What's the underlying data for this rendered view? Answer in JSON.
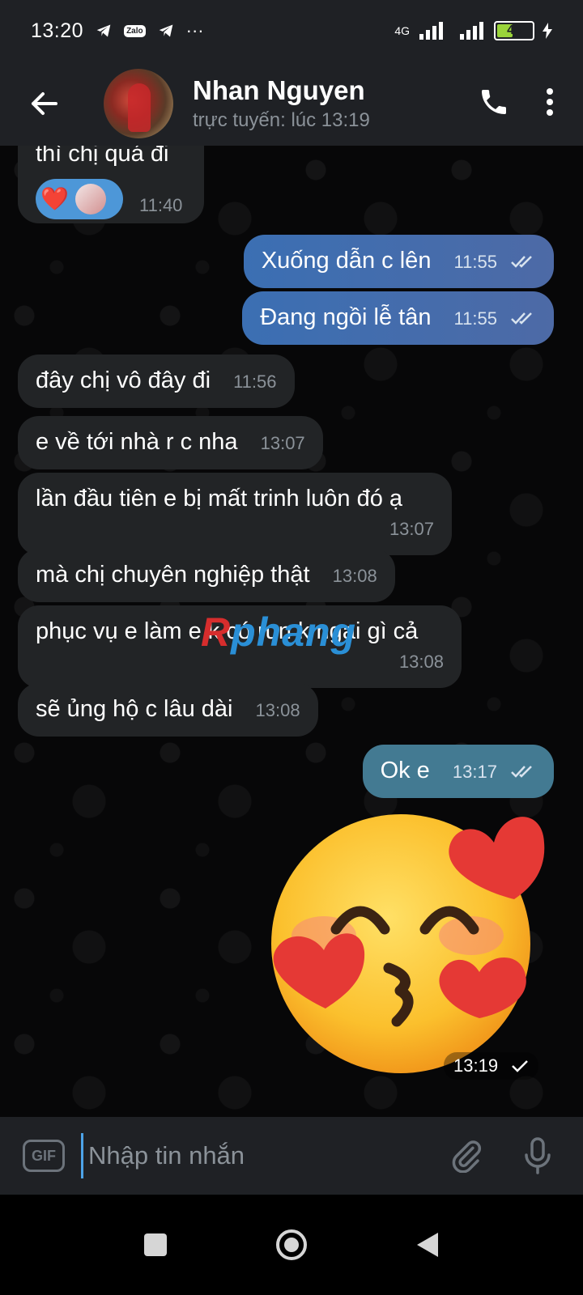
{
  "status_bar": {
    "time": "13:20",
    "network": "4G",
    "battery": "44",
    "zalo": "Zalo",
    "more": "···"
  },
  "header": {
    "name": "Nhan Nguyen",
    "status": "trực tuyến: lúc 13:19"
  },
  "messages": [
    {
      "side": "in",
      "text": "thì chị quá đi",
      "time": "11:40"
    },
    {
      "side": "out",
      "text": "Xuống dẫn c lên",
      "time": "11:55"
    },
    {
      "side": "out",
      "text": "Đang ngồi lễ tân",
      "time": "11:55"
    },
    {
      "side": "in",
      "text": "đây chị vô đây đi",
      "time": "11:56"
    },
    {
      "side": "in",
      "text": "e về tới nhà r c nha",
      "time": "13:07"
    },
    {
      "side": "in",
      "text": "lần đầu tiên e bị mất trinh luôn đó ạ",
      "time": "13:07"
    },
    {
      "side": "in",
      "text": "mà chị chuyên nghiệp thật",
      "time": "13:08"
    },
    {
      "side": "in",
      "text": "phục vụ e làm e k có run k ngại gì cả",
      "time": "13:08"
    },
    {
      "side": "in",
      "text": "sẽ ủng hộ c lâu dài",
      "time": "13:08"
    },
    {
      "side": "out",
      "text": "Ok e",
      "time": "13:17"
    }
  ],
  "reaction": {
    "emoji": "❤️"
  },
  "watermark": {
    "part1": "R",
    "part2": "phang"
  },
  "sticker": {
    "time": "13:19"
  },
  "composer": {
    "gif_label": "GIF",
    "placeholder": "Nhập tin nhắn"
  },
  "colors": {
    "header_bg": "#1f2125",
    "incoming_bubble": "#222426",
    "outgoing_bubble": "#4d6aa6",
    "outgoing_teal": "#437a92",
    "accent": "#4da3e8"
  },
  "icons": [
    "back-arrow-icon",
    "phone-icon",
    "more-vertical-icon",
    "gif-icon",
    "paperclip-icon",
    "microphone-icon",
    "nav-recent-icon",
    "nav-home-icon",
    "nav-back-icon",
    "double-check-icon",
    "single-check-icon"
  ]
}
